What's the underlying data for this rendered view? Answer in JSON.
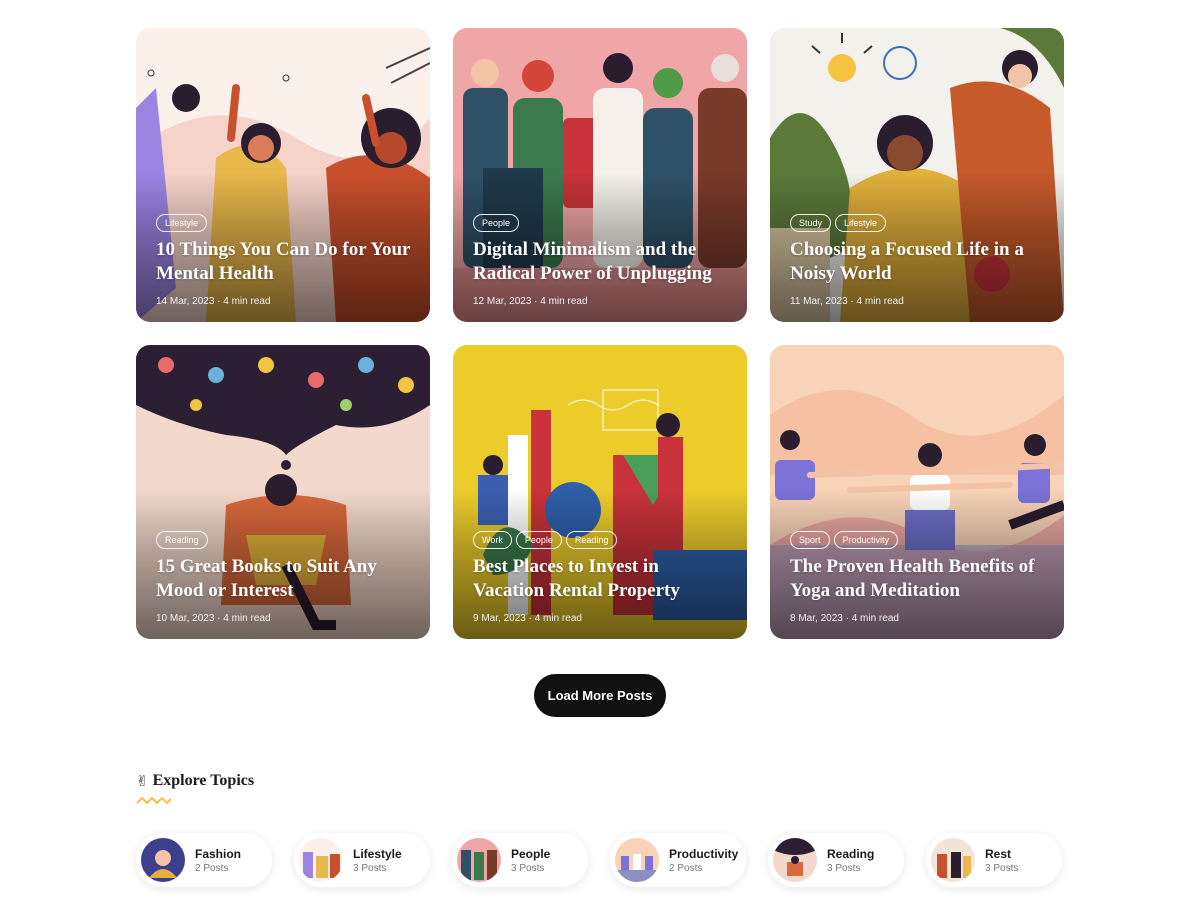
{
  "posts": [
    {
      "title": "10 Things You Can Do for Your Mental Health",
      "tags": [
        "Lifestyle"
      ],
      "date": "14 Mar, 2023",
      "read": "4 min read"
    },
    {
      "title": "Digital Minimalism and the Radical Power of Unplugging",
      "tags": [
        "People"
      ],
      "date": "12 Mar, 2023",
      "read": "4 min read"
    },
    {
      "title": "Choosing a Focused Life in a Noisy World",
      "tags": [
        "Study",
        "Lifestyle"
      ],
      "date": "11 Mar, 2023",
      "read": "4 min read"
    },
    {
      "title": "15 Great Books to Suit Any Mood or Interest",
      "tags": [
        "Reading"
      ],
      "date": "10 Mar, 2023",
      "read": "4 min read"
    },
    {
      "title": "Best Places to Invest in Vacation Rental Property",
      "tags": [
        "Work",
        "People",
        "Reading"
      ],
      "date": "9 Mar, 2023",
      "read": "4 min read"
    },
    {
      "title": "The Proven Health Benefits of Yoga and Meditation",
      "tags": [
        "Sport",
        "Productivity"
      ],
      "date": "8 Mar, 2023",
      "read": "4 min read"
    }
  ],
  "load_more_label": "Load More Posts",
  "topics_section": {
    "emoji": "✌",
    "title": "Explore Topics"
  },
  "topics": [
    {
      "name": "Fashion",
      "count": "2 Posts"
    },
    {
      "name": "Lifestyle",
      "count": "3 Posts"
    },
    {
      "name": "People",
      "count": "3 Posts"
    },
    {
      "name": "Productivity",
      "count": "2 Posts"
    },
    {
      "name": "Reading",
      "count": "3 Posts"
    },
    {
      "name": "Rest",
      "count": "3 Posts"
    }
  ],
  "colors": {
    "button_bg": "#111111",
    "squiggle": "#f2c14e"
  }
}
